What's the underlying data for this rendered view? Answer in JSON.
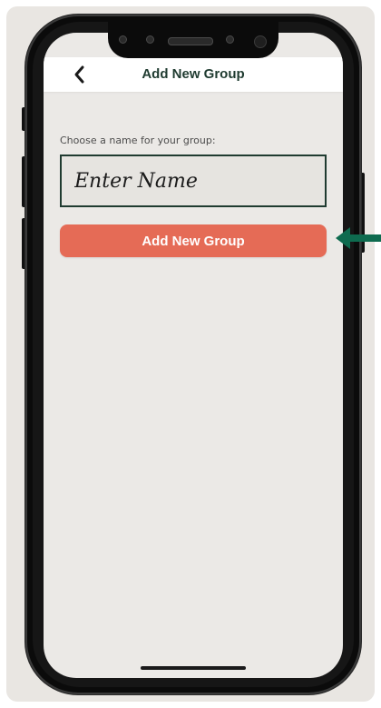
{
  "header": {
    "title": "Add New Group",
    "back_icon": "chevron-left-icon"
  },
  "form": {
    "label": "Choose a name for your group:",
    "name_placeholder": "Enter Name",
    "name_value": ""
  },
  "actions": {
    "add_group_label": "Add New Group"
  },
  "annotation": {
    "arrow_icon": "arrow-left-icon",
    "arrow_color": "#0e6b4f"
  },
  "colors": {
    "accent": "#e56b56",
    "brand_dark": "#1f3b30",
    "screen_background": "#ebe9e6"
  }
}
